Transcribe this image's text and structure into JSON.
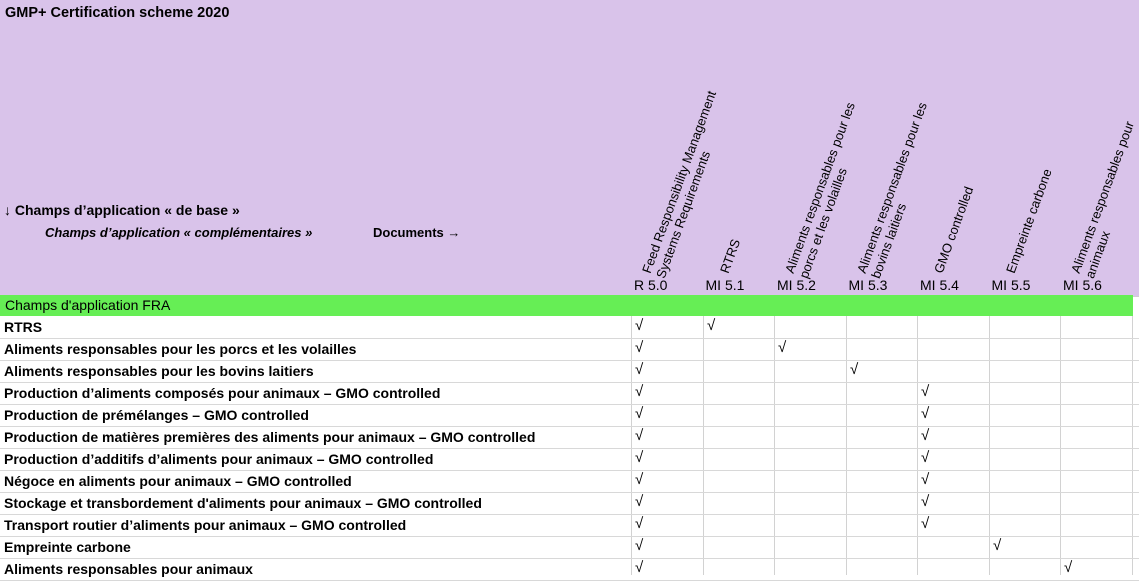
{
  "title": "GMP+ Certification scheme 2020",
  "basic_scope_label": "↓ Champs d’application « de base »",
  "complementary_scope_label": "Champs d’application « complémentaires »",
  "documents_label": "Documents →",
  "columns": [
    {
      "title_lines": [
        "Feed Responsibility Management",
        "Systems Requirements"
      ],
      "code": "R 5.0"
    },
    {
      "title_lines": [
        "RTRS"
      ],
      "code": "MI 5.1"
    },
    {
      "title_lines": [
        "Aliments responsables pour les",
        "porcs et les volailles"
      ],
      "code": "MI 5.2"
    },
    {
      "title_lines": [
        "Aliments responsables pour les",
        "bovins laitiers"
      ],
      "code": "MI 5.3"
    },
    {
      "title_lines": [
        "GMO controlled"
      ],
      "code": "MI 5.4"
    },
    {
      "title_lines": [
        "Empreinte carbone"
      ],
      "code": "MI 5.5"
    },
    {
      "title_lines": [
        "Aliments responsables pour",
        "animaux"
      ],
      "code": "MI 5.6"
    }
  ],
  "section_label": "Champs d'application FRA",
  "check_symbol": "√",
  "rows": [
    {
      "label": " RTRS",
      "checks": [
        0,
        1
      ]
    },
    {
      "label": "Aliments responsables pour les porcs et les volailles",
      "checks": [
        0,
        2
      ]
    },
    {
      "label": "Aliments responsables pour les bovins laitiers",
      "checks": [
        0,
        3
      ]
    },
    {
      "label": "Production d’aliments composés pour animaux – GMO controlled",
      "checks": [
        0,
        4
      ]
    },
    {
      "label": "Production de prémélanges – GMO controlled",
      "checks": [
        0,
        4
      ]
    },
    {
      "label": "Production de matières premières des aliments pour animaux – GMO controlled",
      "checks": [
        0,
        4
      ]
    },
    {
      "label": "Production d’additifs d’aliments pour animaux – GMO controlled",
      "checks": [
        0,
        4
      ]
    },
    {
      "label": "Négoce en aliments pour animaux – GMO controlled",
      "checks": [
        0,
        4
      ]
    },
    {
      "label": "Stockage et transbordement d'aliments pour animaux – GMO controlled",
      "checks": [
        0,
        4
      ]
    },
    {
      "label": "Transport routier d’aliments pour animaux – GMO controlled",
      "checks": [
        0,
        4
      ]
    },
    {
      "label": "Empreinte carbone",
      "checks": [
        0,
        5
      ]
    },
    {
      "label": "Aliments responsables pour animaux",
      "checks": [
        0,
        6
      ]
    }
  ],
  "colors": {
    "header_bg": "#d9c3ea",
    "section_bg": "#66ee55"
  }
}
